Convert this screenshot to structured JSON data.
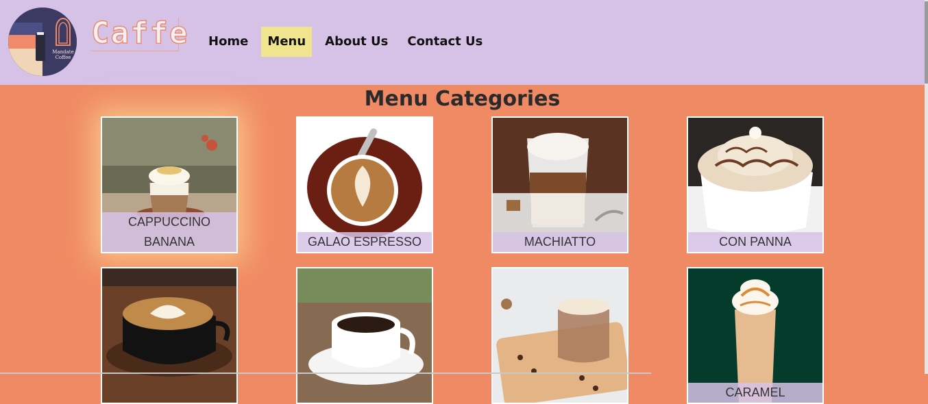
{
  "header": {
    "logo_alt": "Mandate Coffee",
    "logo_text_line1": "Mandate",
    "logo_text_line2": "Coffee",
    "wordmark": "Caffe"
  },
  "nav": {
    "items": [
      {
        "label": "Home",
        "active": false
      },
      {
        "label": "Menu",
        "active": true
      },
      {
        "label": "About Us",
        "active": false
      },
      {
        "label": "Contact Us",
        "active": false
      }
    ]
  },
  "main": {
    "title": "Menu Categories",
    "categories": [
      {
        "name": "CAPPUCCINO BANANA",
        "line1": "CAPPUCCINO",
        "line2": "BANANA"
      },
      {
        "name": "GALAO ESPRESSO"
      },
      {
        "name": "MACHIATTO"
      },
      {
        "name": "CON PANNA"
      },
      {
        "name": ""
      },
      {
        "name": ""
      },
      {
        "name": ""
      },
      {
        "name": "CARAMEL"
      }
    ]
  },
  "colors": {
    "header_bg": "#d6c2e6",
    "page_bg": "#f08a64",
    "active_nav_bg": "#f0e48f",
    "label_bg": "#d6c2e6"
  }
}
